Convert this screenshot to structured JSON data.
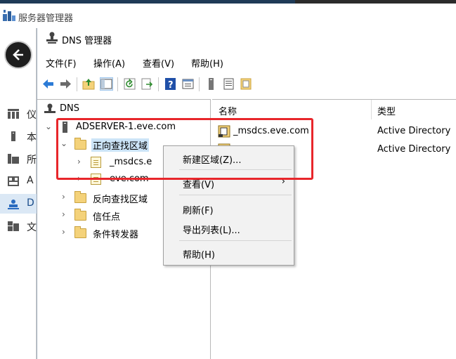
{
  "server_manager": {
    "title": "服务器管理器",
    "nav_items": [
      {
        "label": "仪",
        "icon": "dashboard-icon"
      },
      {
        "label": "本",
        "icon": "local-server-icon"
      },
      {
        "label": "所",
        "icon": "all-servers-icon"
      },
      {
        "label": "A",
        "icon": "ad-icon"
      },
      {
        "label": "D",
        "icon": "dns-icon",
        "active": true
      },
      {
        "label": "文",
        "icon": "file-services-icon"
      }
    ]
  },
  "dns_manager": {
    "title": "DNS 管理器",
    "menu": [
      "文件(F)",
      "操作(A)",
      "查看(V)",
      "帮助(H)"
    ],
    "tree": {
      "root": "DNS",
      "server": "ADSERVER-1.eve.com",
      "forward_zones": "正向查找区域",
      "zone_msdcs": "_msdcs.e",
      "zone_eve": "eve.com",
      "reverse_zones": "反向查找区域",
      "trust_points": "信任点",
      "conditional_forwarders": "条件转发器"
    },
    "list": {
      "columns": [
        "名称",
        "类型"
      ],
      "rows": [
        {
          "name": "_msdcs.eve.com",
          "type": "Active Directory"
        },
        {
          "name": "",
          "type": "Active Directory"
        }
      ]
    }
  },
  "context_menu": {
    "new_zone": "新建区域(Z)...",
    "view": "查看(V)",
    "view_arrow": "›",
    "refresh": "刷新(F)",
    "export": "导出列表(L)...",
    "help": "帮助(H)"
  },
  "colors": {
    "highlight_box": "#e8262b",
    "selection": "#cce4f7",
    "nav_active": "#dbe8f5"
  }
}
